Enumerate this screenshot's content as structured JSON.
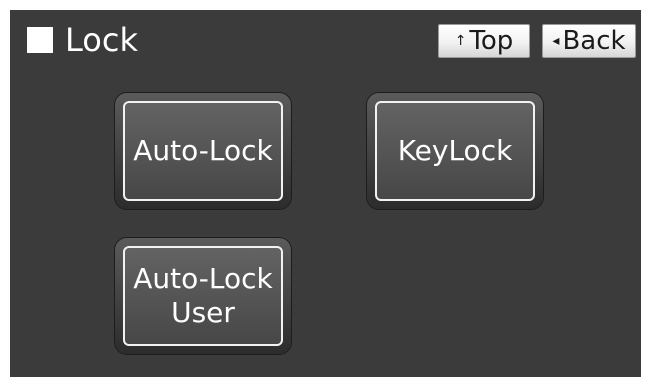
{
  "header": {
    "title": "Lock",
    "top_label": "Top",
    "top_icon": "↑",
    "back_label": "Back",
    "back_icon": "◂"
  },
  "buttons": {
    "auto_lock": "Auto-Lock",
    "key_lock": "KeyLock",
    "auto_lock_user_line1": "Auto-Lock",
    "auto_lock_user_line2": "User"
  },
  "colors": {
    "screen_background": "#3b3b3b",
    "text": "#ffffff",
    "nav_button_face": "#f2f2f2"
  },
  "icons": {
    "title_marker": "square-icon",
    "top": "arrow-up-icon",
    "back": "triangle-left-icon"
  }
}
